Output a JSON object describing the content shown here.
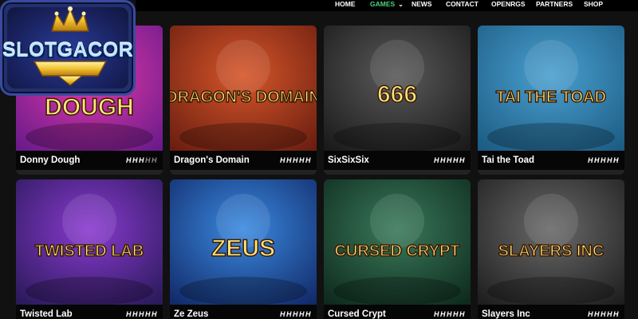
{
  "brand": {
    "logo_text": "SLOTGACOR"
  },
  "nav": {
    "items": [
      {
        "label": "HOME"
      },
      {
        "label": "GAMES",
        "active": true,
        "has_dropdown": true
      },
      {
        "label": "NEWS"
      },
      {
        "label": "CONTACT"
      },
      {
        "label": "OPENRGS"
      },
      {
        "label": "PARTNERS"
      },
      {
        "label": "SHOP"
      }
    ]
  },
  "games": [
    {
      "title": "Donny Dough",
      "volatility": "HHHHH",
      "volatility_level": 3,
      "art_text": "Donny\nDOUGH",
      "colors": [
        "#e23aa8",
        "#6a1a8a"
      ]
    },
    {
      "title": "Dragon's Domain",
      "volatility": "HHHHH",
      "volatility_level": 5,
      "art_text": "DRAGON'S DOMAIN",
      "colors": [
        "#d6562a",
        "#6b1e10"
      ]
    },
    {
      "title": "SixSixSix",
      "volatility": "HHHHH",
      "volatility_level": 5,
      "art_text": "666",
      "colors": [
        "#5a5a5a",
        "#1a1a1a"
      ]
    },
    {
      "title": "Tai the Toad",
      "volatility": "HHHHH",
      "volatility_level": 5,
      "art_text": "TAI THE TOAD",
      "colors": [
        "#4aa0d0",
        "#1c5c84"
      ]
    },
    {
      "title": "Twisted Lab",
      "volatility": "HHHHH",
      "volatility_level": 5,
      "art_text": "TWISTED LAB",
      "colors": [
        "#8a3ad0",
        "#2a1a5a"
      ]
    },
    {
      "title": "Ze Zeus",
      "volatility": "HHHHH",
      "volatility_level": 5,
      "art_text": "ZEUS",
      "colors": [
        "#3a8ae0",
        "#122a6a"
      ]
    },
    {
      "title": "Cursed Crypt",
      "volatility": "HHHHH",
      "volatility_level": 5,
      "art_text": "CURSED CRYPT",
      "colors": [
        "#3a7a5a",
        "#0e2a1e"
      ]
    },
    {
      "title": "Slayers Inc",
      "volatility": "HHHHH",
      "volatility_level": 5,
      "art_text": "SLAYERS INC",
      "colors": [
        "#6a6a6a",
        "#1e1e1e"
      ]
    }
  ]
}
